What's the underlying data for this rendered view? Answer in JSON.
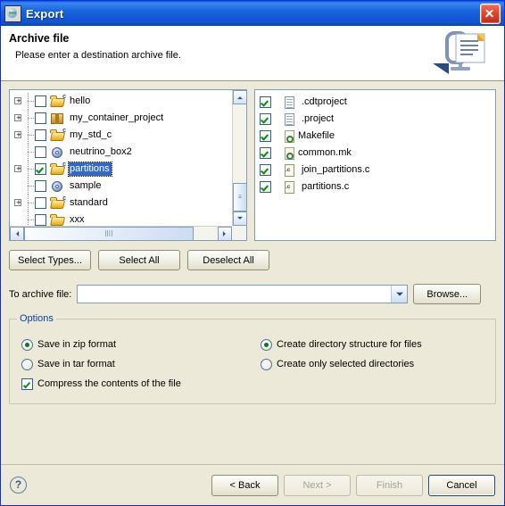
{
  "window": {
    "title": "Export",
    "title_icon": "export-globe-icon",
    "close_icon": "close-icon"
  },
  "header": {
    "title": "Archive file",
    "description": "Please enter a destination archive file.",
    "graphic": "archive-export-banner-icon"
  },
  "tree": {
    "items": [
      {
        "label": "hello",
        "icon": "c-project-folder-icon",
        "expandable": true,
        "checked": false
      },
      {
        "label": "my_container_project",
        "icon": "container-project-icon",
        "expandable": true,
        "checked": false
      },
      {
        "label": "my_std_c",
        "icon": "c-project-folder-icon",
        "expandable": true,
        "checked": false
      },
      {
        "label": "neutrino_box2",
        "icon": "disc-project-icon",
        "expandable": false,
        "checked": false
      },
      {
        "label": "partitions",
        "icon": "c-project-folder-icon",
        "expandable": true,
        "checked": true,
        "selected": true
      },
      {
        "label": "sample",
        "icon": "disc-project-icon",
        "expandable": false,
        "checked": false
      },
      {
        "label": "standard",
        "icon": "c-project-folder-icon",
        "expandable": true,
        "checked": false
      },
      {
        "label": "xxx",
        "icon": "folder-icon",
        "expandable": false,
        "checked": false
      }
    ],
    "scroll": {
      "up_icon": "scroll-up-arrow-icon",
      "down_icon": "scroll-down-arrow-icon",
      "left_icon": "scroll-left-arrow-icon",
      "right_icon": "scroll-right-arrow-icon",
      "grip": "||||"
    }
  },
  "file_list": {
    "items": [
      {
        "label": ".cdtproject",
        "icon": "document-icon",
        "checked": true
      },
      {
        "label": ".project",
        "icon": "document-icon",
        "checked": true
      },
      {
        "label": "Makefile",
        "icon": "makefile-icon",
        "checked": true
      },
      {
        "label": "common.mk",
        "icon": "makefile-icon",
        "checked": true
      },
      {
        "label": "join_partitions.c",
        "icon": "c-source-icon",
        "checked": true
      },
      {
        "label": "partitions.c",
        "icon": "c-source-icon",
        "checked": true
      }
    ],
    "c_badge": ".c"
  },
  "type_buttons": {
    "select_types": "Select Types...",
    "select_all": "Select All",
    "deselect_all": "Deselect All"
  },
  "archive": {
    "label": "To archive file:",
    "value": "",
    "placeholder": "",
    "dropdown_icon": "chevron-down-icon",
    "browse": "Browse..."
  },
  "options": {
    "legend": "Options",
    "left": [
      {
        "label": "Save in zip format",
        "type": "radio",
        "selected": true
      },
      {
        "label": "Save in tar format",
        "type": "radio",
        "selected": false
      },
      {
        "label": "Compress the contents of the file",
        "type": "checkbox",
        "selected": true
      }
    ],
    "right": [
      {
        "label": "Create directory structure for files",
        "type": "radio",
        "selected": true
      },
      {
        "label": "Create only selected directories",
        "type": "radio",
        "selected": false
      }
    ]
  },
  "footer": {
    "help_icon": "?",
    "buttons": [
      {
        "label": "< Back",
        "enabled": true,
        "default": false
      },
      {
        "label": "Next >",
        "enabled": false,
        "default": false
      },
      {
        "label": "Finish",
        "enabled": false,
        "default": false
      },
      {
        "label": "Cancel",
        "enabled": true,
        "default": true
      }
    ]
  },
  "colors": {
    "titlebar": "#0f53cf",
    "dialog_bg": "#ece9d8",
    "selection": "#316ac5",
    "legend_text": "#0a3e9e",
    "check_green": "#0d8a1c"
  }
}
